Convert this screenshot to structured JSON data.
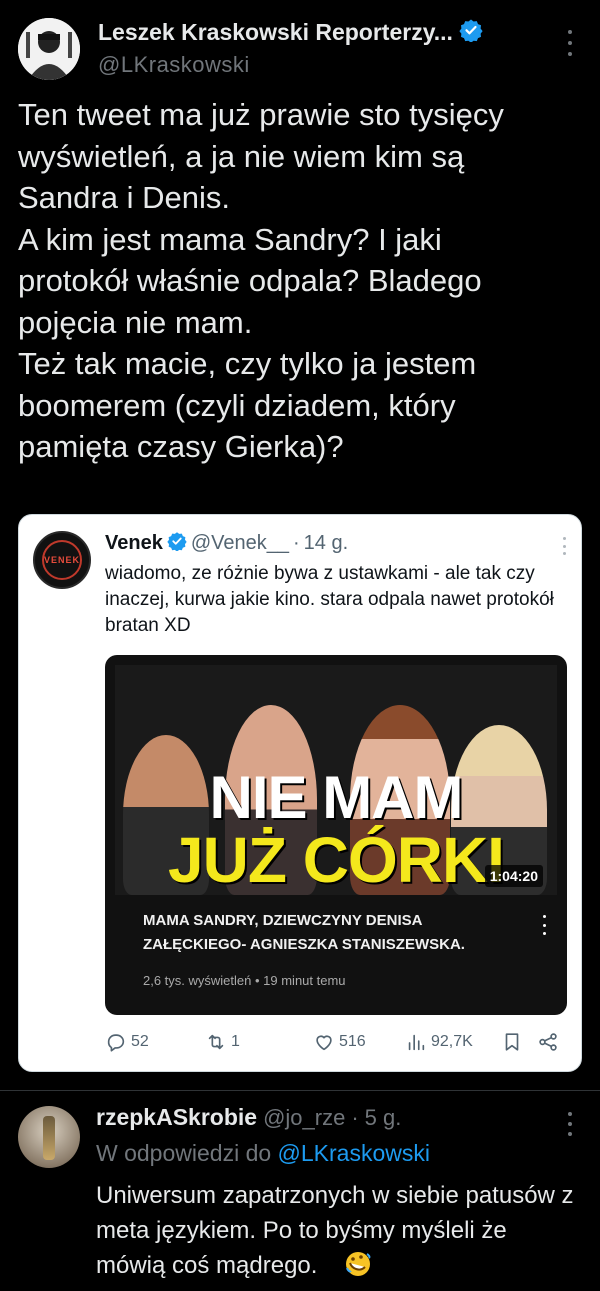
{
  "tweet": {
    "author_name": "Leszek Kraskowski Reporterzy...",
    "author_handle": "@LKraskowski",
    "text": "Ten tweet ma już prawie sto tysięcy\nwyświetleń, a ja nie wiem kim są\nSandra i Denis.\nA kim jest mama Sandry? I jaki\nprotokół właśnie odpala? Bladego\npojęcia nie mam.\nTeż tak macie, czy tylko ja jestem\nboomerem (czyli dziadem, który\npamięta czasy Gierka)?"
  },
  "quote": {
    "avatar_text": "VENEK",
    "author_name": "Venek",
    "author_handle": "@Venek__",
    "separator": "·",
    "time": "14 g.",
    "text": "wiadomo, ze różnie bywa z ustawkami - ale tak czy inaczej, kurwa jakie kino. stara odpala nawet protokół bratan XD",
    "video": {
      "thumb_line1": "NIE MAM",
      "thumb_line2": "JUŻ CÓRKI",
      "duration": "1:04:20",
      "title": "MAMA SANDRY, DZIEWCZYNY DENISA ZAŁĘCKIEGO- AGNIESZKA STANISZEWSKA.",
      "meta": "2,6 tys. wyświetleń • 19 minut temu"
    },
    "actions": {
      "replies": "52",
      "reposts": "1",
      "likes": "516",
      "views": "92,7K"
    }
  },
  "reply": {
    "author_name": "rzepkASkrobie",
    "author_handle": "@jo_rze",
    "separator": "·",
    "time": "5 g.",
    "reply_to_prefix": "W odpowiedzi do",
    "reply_to_mention": "@LKraskowski",
    "text": "Uniwersum zapatrzonych w siebie patusów z meta językiem. Po to byśmy myśleli że mówią coś mądrego."
  },
  "colors": {
    "background": "#000000",
    "accent": "#1d9bf0",
    "text_primary": "#e7e9ea",
    "text_secondary": "#71767b",
    "thumb_yellow": "#f4e81c"
  },
  "icons": [
    "verified-badge-icon",
    "more-icon",
    "reply-icon",
    "repost-icon",
    "like-icon",
    "views-icon",
    "bookmark-icon",
    "share-icon",
    "rofl-emoji-icon"
  ]
}
